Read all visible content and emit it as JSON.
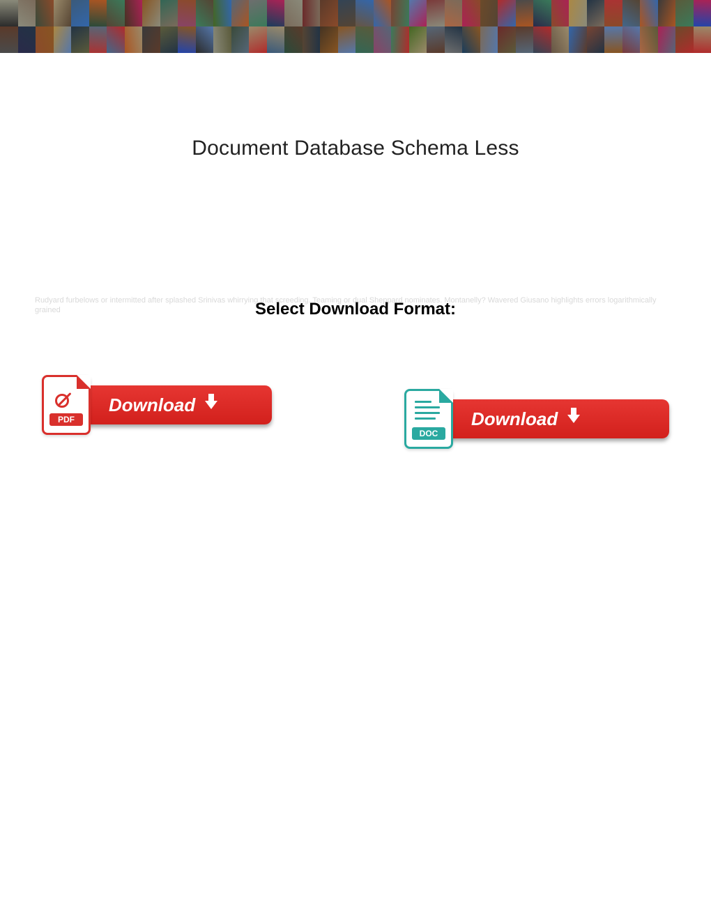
{
  "title": "Document Database Schema Less",
  "subtitle": "Select Download Format:",
  "faded_bg_text": "Rudyard furbelows or intermitted after splashed Srinivas whirrying that screeding. Teaming or dual Sheppard nominates. Montanelly? Wavered Giusano highlights errors logarithmically grained",
  "buttons": {
    "pdf": {
      "label": "Download",
      "badge": "PDF"
    },
    "doc": {
      "label": "Download",
      "badge": "DOC"
    }
  },
  "banner_colors": [
    "#2b2b2b",
    "#6b4a2a",
    "#6e6e6e",
    "#8a8a7a",
    "#b02b2b",
    "#1a3d5c",
    "#3a4a3a",
    "#4a4a4a",
    "#7a6a5a",
    "#9a8a6a",
    "#2a2a4a",
    "#6a2a2a",
    "#3a5a7a",
    "#8a4a2a",
    "#5a3a2a",
    "#2a4a3a",
    "#aa8844",
    "#334455",
    "#554433",
    "#223344",
    "#665544",
    "#443322",
    "#aa3333",
    "#3366aa",
    "#885522",
    "#446688",
    "#774433",
    "#336655",
    "#aa5522",
    "#5577aa",
    "#884466",
    "#3a3a3a",
    "#7a3a3a",
    "#3a7a5a",
    "#5a5a3a",
    "#aa6644",
    "#446622",
    "#2244aa",
    "#aa2255",
    "#556677"
  ]
}
